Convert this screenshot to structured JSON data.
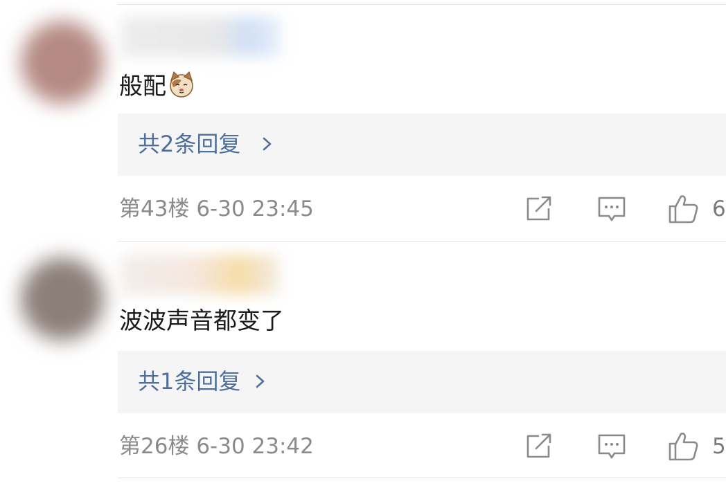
{
  "comments": [
    {
      "text": "般配",
      "emoji": "cat-face",
      "replies_label": "共2条回复",
      "floor": "第43楼",
      "time": "6-30 23:45",
      "likes": "6"
    },
    {
      "text": "波波声音都变了",
      "replies_label": "共1条回复",
      "floor": "第26楼",
      "time": "6-30 23:42",
      "likes": "5"
    }
  ],
  "colors": {
    "reply_link": "#4e6f9c",
    "meta_text": "#8a8a8a",
    "reply_bg": "#f5f5f5",
    "divider": "#e4e4e4"
  },
  "icons": [
    "share-icon",
    "comment-icon",
    "thumbs-up-icon",
    "chevron-right-icon",
    "cat-emoji"
  ]
}
